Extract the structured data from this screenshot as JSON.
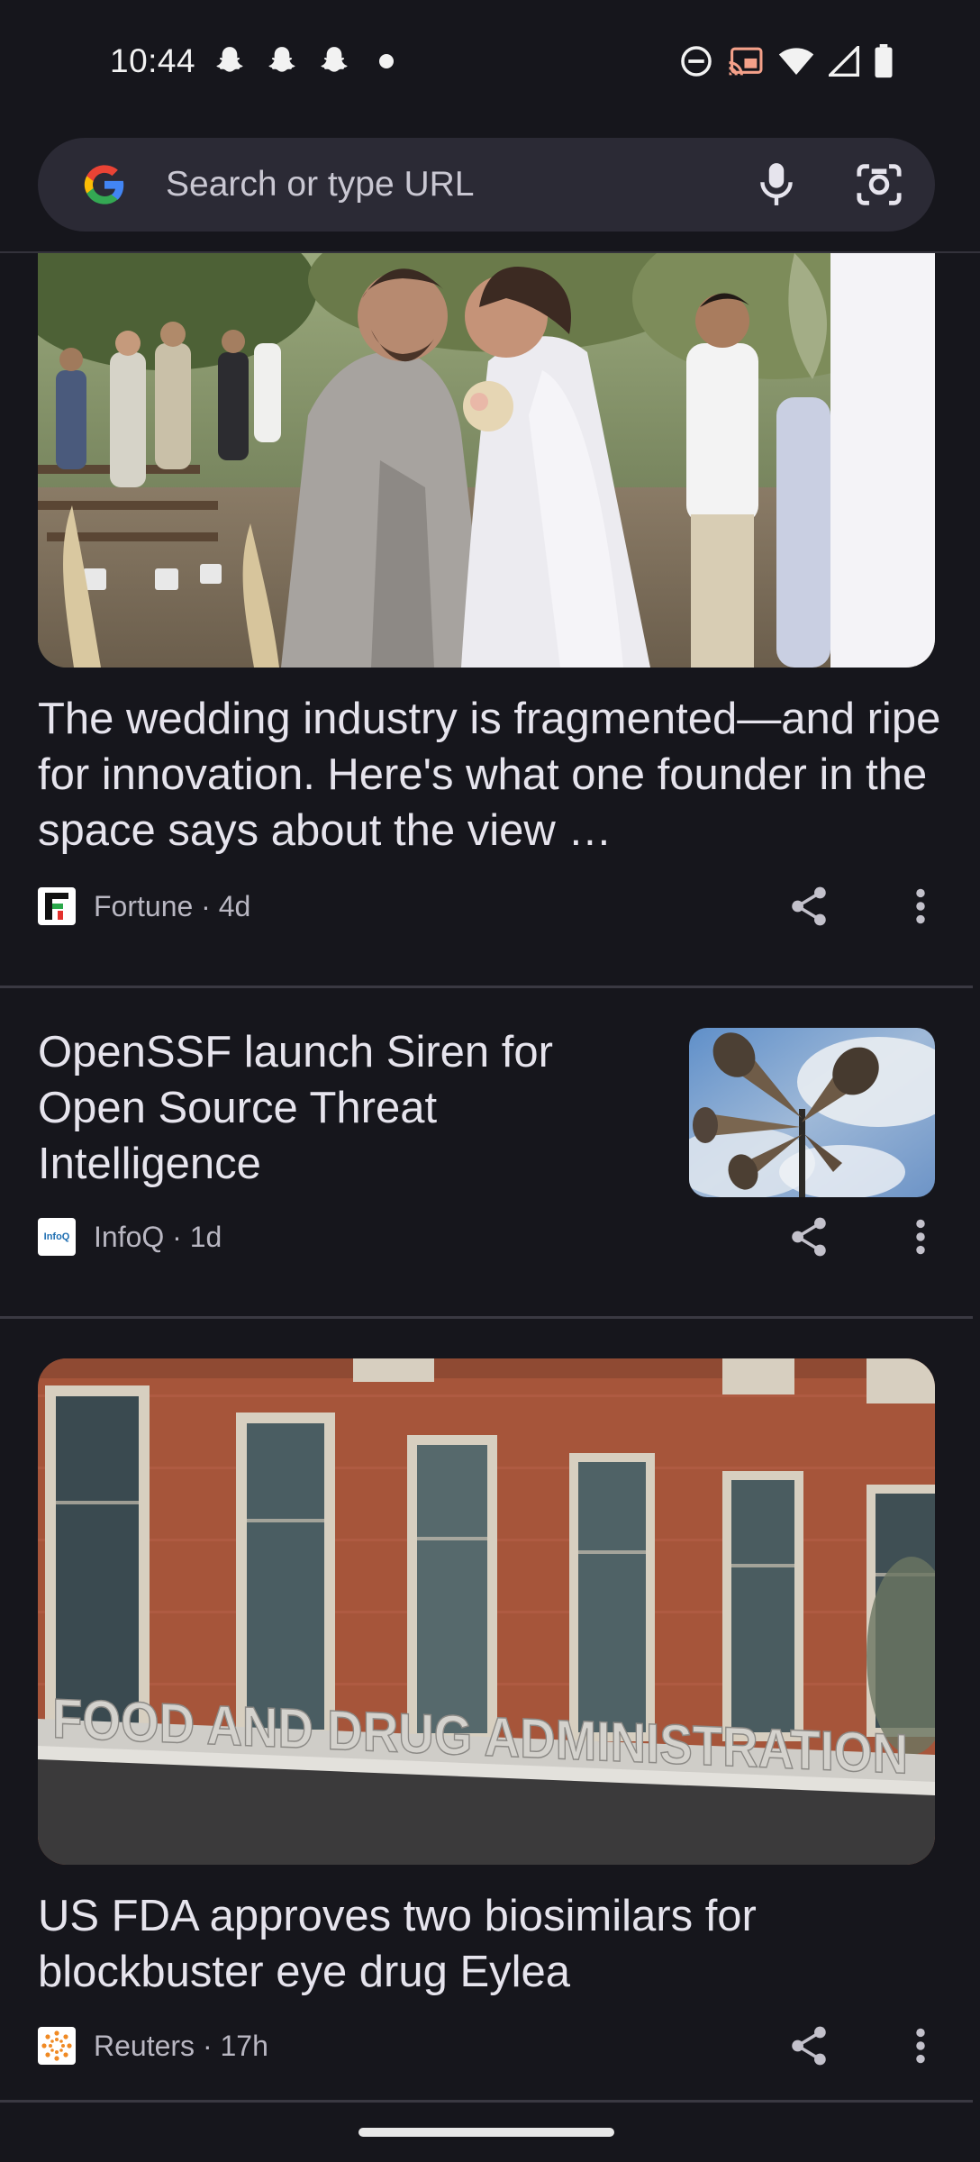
{
  "status_bar": {
    "time": "10:44",
    "notification_icons": [
      "snapchat-icon",
      "snapchat-icon",
      "snapchat-icon",
      "more-dot-icon"
    ],
    "system_icons": [
      "do-not-disturb-icon",
      "cast-icon",
      "wifi-icon",
      "cellular-signal-icon",
      "battery-icon"
    ]
  },
  "search": {
    "placeholder": "Search or type URL",
    "brand_icon": "google-g-icon",
    "voice_icon": "microphone-icon",
    "lens_icon": "camera-lens-icon"
  },
  "articles": [
    {
      "headline": "The wedding industry is fragmented—and ripe for innovation. Here's what one founder in the space says about the view …",
      "source": "Fortune",
      "age": "4d",
      "meta": "Fortune · 4d",
      "image_subject": "wedding-couple-image"
    },
    {
      "headline": "OpenSSF launch Siren for Open Source Threat Intelligence",
      "source": "InfoQ",
      "age": "1d",
      "meta": "InfoQ · 1d",
      "logo_text": "InfoQ",
      "image_subject": "siren-loudspeakers-image"
    },
    {
      "headline": "US FDA approves two biosimilars for blockbuster eye drug Eylea",
      "source": "Reuters",
      "age": "17h",
      "meta": "Reuters · 17h",
      "image_subject": "fda-building-image",
      "image_sign_text": "FOOD AND DRUG ADMINISTRATION"
    }
  ],
  "colors": {
    "background": "#16161c",
    "search_bg": "#2b2a35",
    "text_primary": "#e6e4ed",
    "text_secondary": "#b9b7c2"
  }
}
